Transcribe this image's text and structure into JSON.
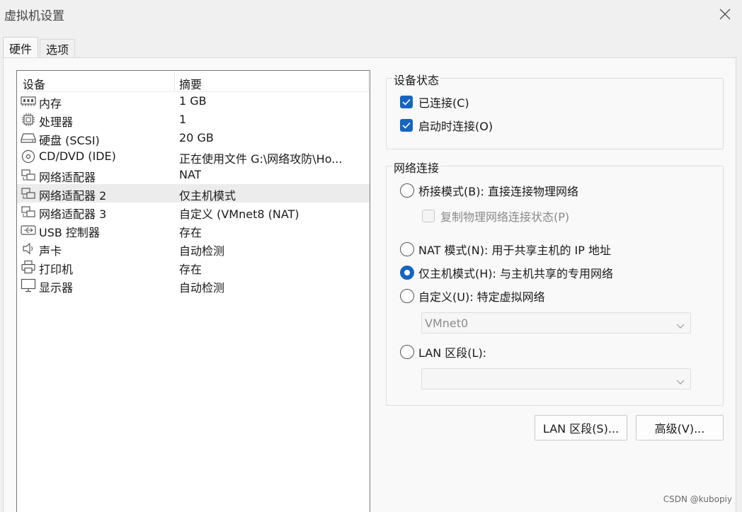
{
  "window": {
    "title": "虚拟机设置"
  },
  "tabs": [
    {
      "label": "硬件",
      "active": true
    },
    {
      "label": "选项",
      "active": false
    }
  ],
  "device_list": {
    "headers": {
      "device": "设备",
      "summary": "摘要"
    },
    "rows": [
      {
        "icon": "memory-icon",
        "name": "内存",
        "summary": "1 GB"
      },
      {
        "icon": "cpu-icon",
        "name": "处理器",
        "summary": "1"
      },
      {
        "icon": "harddisk-icon",
        "name": "硬盘 (SCSI)",
        "summary": "20 GB"
      },
      {
        "icon": "cd-dvd-icon",
        "name": "CD/DVD (IDE)",
        "summary": "正在使用文件 G:\\网络攻防\\Ho..."
      },
      {
        "icon": "network-adapter-icon",
        "name": "网络适配器",
        "summary": "NAT"
      },
      {
        "icon": "network-adapter-icon",
        "name": "网络适配器 2",
        "summary": "仅主机模式",
        "selected": true
      },
      {
        "icon": "network-adapter-icon",
        "name": "网络适配器 3",
        "summary": "自定义 (VMnet8 (NAT)"
      },
      {
        "icon": "usb-icon",
        "name": "USB 控制器",
        "summary": "存在"
      },
      {
        "icon": "speaker-icon",
        "name": "声卡",
        "summary": "自动检测"
      },
      {
        "icon": "printer-icon",
        "name": "打印机",
        "summary": "存在"
      },
      {
        "icon": "monitor-icon",
        "name": "显示器",
        "summary": "自动检测"
      }
    ]
  },
  "device_status": {
    "title": "设备状态",
    "connected": {
      "label": "已连接(C)",
      "checked": true
    },
    "connect_at_power_on": {
      "label": "启动时连接(O)",
      "checked": true
    }
  },
  "network_connection": {
    "title": "网络连接",
    "bridged": {
      "label": "桥接模式(B): 直接连接物理网络",
      "selected": false
    },
    "replicate_state": {
      "label": "复制物理网络连接状态(P)",
      "checked": false
    },
    "nat": {
      "label": "NAT 模式(N): 用于共享主机的 IP 地址",
      "selected": false
    },
    "host_only": {
      "label": "仅主机模式(H): 与主机共享的专用网络",
      "selected": true
    },
    "custom": {
      "label": "自定义(U): 特定虚拟网络",
      "selected": false
    },
    "custom_select_value": "VMnet0",
    "lan_segment": {
      "label": "LAN 区段(L):",
      "selected": false
    },
    "lan_select_value": ""
  },
  "buttons": {
    "lan_segments": "LAN 区段(S)...",
    "advanced": "高级(V)..."
  },
  "watermark": "CSDN @kubopiy",
  "colors": {
    "accent": "#1565c0",
    "selected_row": "#ececec"
  }
}
